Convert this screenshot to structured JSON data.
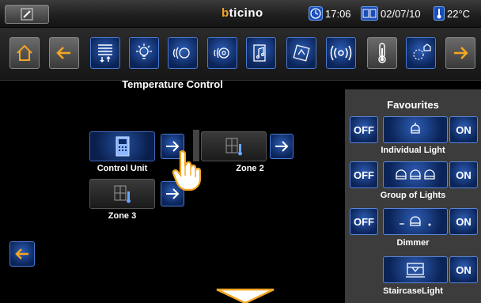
{
  "status": {
    "brand_b": "b",
    "brand_rest": "ticino",
    "time": "17:06",
    "date": "02/07/10",
    "temperature": "22°C"
  },
  "toolbar": {
    "buttons": [
      "home-icon",
      "back-arrow-icon",
      "blinds-icon",
      "light-bulb-icon",
      "dimmer-light-icon",
      "light-group-icon",
      "audio-icon",
      "scenario-icon",
      "radio-waves-icon",
      "thermometer-icon",
      "energy-icon",
      "forward-arrow-icon"
    ]
  },
  "main": {
    "title": "Temperature Control",
    "zones": [
      {
        "label": "Control Unit",
        "icon": "control-unit-icon"
      },
      {
        "label": "Zone 2",
        "icon": "zone-thermometer-icon"
      },
      {
        "label": "Zone 3",
        "icon": "zone-thermometer-icon"
      }
    ]
  },
  "favourites": {
    "title": "Favourites",
    "off_label": "OFF",
    "on_label": "ON",
    "items": [
      {
        "label": "Individual Light",
        "icon": "lamp-icon"
      },
      {
        "label": "Group of Lights",
        "icon": "lamps-group-icon"
      },
      {
        "label": "Dimmer",
        "icon": "dimmer-icon"
      },
      {
        "label": "StaircaseLight",
        "icon": "staircase-light-icon"
      }
    ]
  },
  "colors": {
    "accent": "#2c5db6",
    "orange": "#f5a623",
    "panel": "#3c3c3c"
  }
}
